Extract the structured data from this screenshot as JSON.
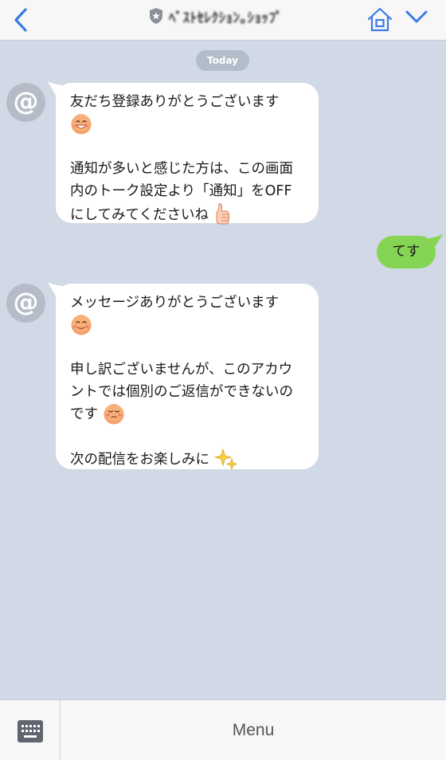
{
  "header": {
    "title": "ﾍﾞｽﾄｾﾚｸｼｮﾝ｡ｼｮｯﾌﾟ",
    "back_icon": "chevron-left-icon",
    "home_icon": "home-icon",
    "menu_icon": "chevron-down-icon",
    "accent_color": "#3b7be8"
  },
  "date_divider": "Today",
  "messages": [
    {
      "sender": "bot",
      "avatar": "@",
      "lines": [
        "友だち登録ありがとうございます",
        "",
        "",
        "通知が多いと感じた方は、この画面",
        "内のトーク設定より「通知」をOFF",
        "にしてみてくださいね"
      ]
    },
    {
      "sender": "me",
      "text": "てす"
    },
    {
      "sender": "bot",
      "avatar": "@",
      "lines": [
        "メッセージありがとうございます",
        "",
        "",
        "申し訳ございませんが、このアカウ",
        "ントでは個別のご返信ができないの",
        "です",
        "",
        "次の配信をお楽しみに"
      ]
    }
  ],
  "bottom_bar": {
    "keyboard_icon": "keyboard-icon",
    "menu_label": "Menu"
  },
  "colors": {
    "background": "#d0d9e5",
    "my_bubble": "#86d453",
    "bot_bubble": "#ffffff"
  }
}
